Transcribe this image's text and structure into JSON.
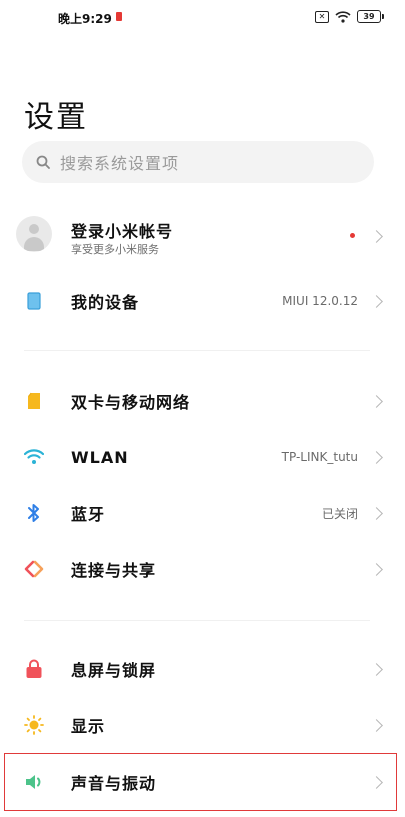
{
  "status_bar": {
    "time": "晚上9:29",
    "battery": "39"
  },
  "page": {
    "title": "设置"
  },
  "search": {
    "placeholder": "搜索系统设置项"
  },
  "account": {
    "title": "登录小米帐号",
    "subtitle": "享受更多小米服务"
  },
  "device": {
    "label": "我的设备",
    "value": "MIUI 12.0.12"
  },
  "network": [
    {
      "label": "双卡与移动网络",
      "value": ""
    },
    {
      "label": "WLAN",
      "value": "TP-LINK_tutu"
    },
    {
      "label": "蓝牙",
      "value": "已关闭"
    },
    {
      "label": "连接与共享",
      "value": ""
    }
  ],
  "personal": [
    {
      "label": "息屏与锁屏"
    },
    {
      "label": "显示"
    },
    {
      "label": "声音与振动"
    }
  ],
  "colors": {
    "highlight": "#e03a3a",
    "wifi": "#2bb3d6",
    "bluetooth": "#2f7fe6",
    "lock": "#f0525a",
    "sound": "#4cc38a"
  }
}
